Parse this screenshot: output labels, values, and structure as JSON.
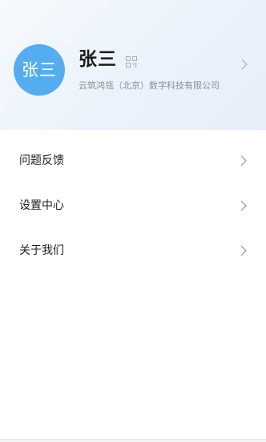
{
  "profile": {
    "avatar_text": "张三",
    "name": "张三",
    "company": "云筑鸿瓴（北京）数字科技有限公司"
  },
  "menu": {
    "items": [
      {
        "label": "问题反馈"
      },
      {
        "label": "设置中心"
      },
      {
        "label": "关于我们"
      }
    ]
  },
  "icons": {
    "qr": "qr-code-icon",
    "chevron": "chevron-right-icon"
  },
  "colors": {
    "avatar_bg": "#55adf0",
    "header_bg": "#eaf2fb",
    "secondary_text": "#8a8f99",
    "chevron": "#b3b7bd"
  }
}
